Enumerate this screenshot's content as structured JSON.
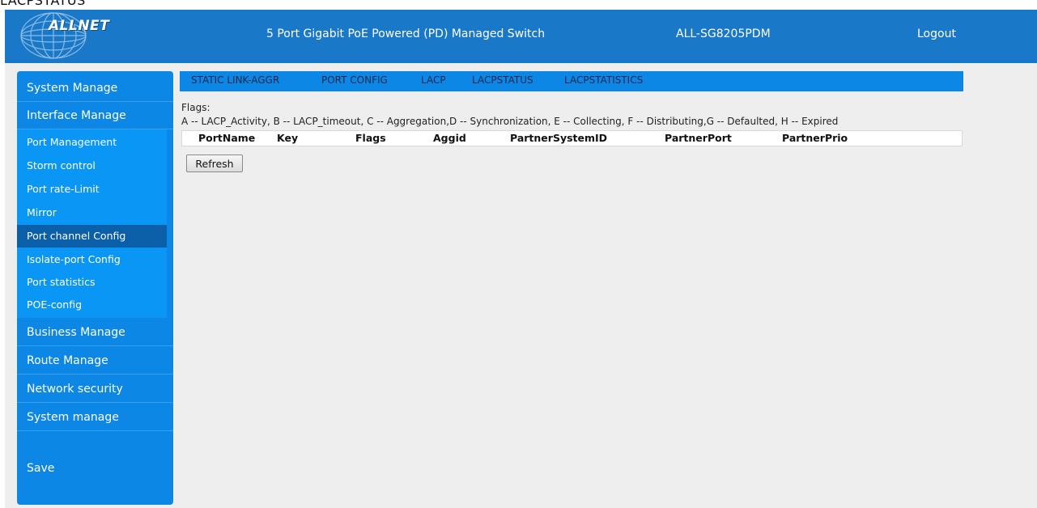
{
  "page_heading": "LACPSTATUS",
  "header": {
    "logo_text": "ALLNET",
    "title": "5 Port Gigabit PoE Powered (PD) Managed Switch",
    "model": "ALL-SG8205PDM",
    "logout_label": "Logout",
    "background_color": "#1a78c8"
  },
  "sidebar": {
    "background_color": "#0c87e6",
    "items_top": [
      {
        "label": "System Manage"
      },
      {
        "label": "Interface Manage"
      }
    ],
    "submenu": [
      {
        "label": "Port Management"
      },
      {
        "label": "Storm control"
      },
      {
        "label": "Port rate-Limit"
      },
      {
        "label": "Mirror"
      },
      {
        "label": "Port channel Config",
        "active": true
      },
      {
        "label": "Isolate-port Config"
      },
      {
        "label": "Port statistics"
      },
      {
        "label": "POE-config"
      }
    ],
    "items_bottom": [
      {
        "label": "Business Manage"
      },
      {
        "label": "Route Manage"
      },
      {
        "label": "Network security"
      },
      {
        "label": "System manage"
      }
    ],
    "save_label": "Save"
  },
  "tabs": [
    {
      "label": "STATIC LINK-AGGR"
    },
    {
      "label": "PORT CONFIG"
    },
    {
      "label": "LACP"
    },
    {
      "label": "LACPSTATUS",
      "active": true
    },
    {
      "label": "LACPSTATISTICS"
    }
  ],
  "flags": {
    "label": "Flags:",
    "legend": "A -- LACP_Activity, B -- LACP_timeout, C -- Aggregation,D -- Synchronization, E -- Collecting, F -- Distributing,G -- Defaulted, H -- Expired"
  },
  "table": {
    "columns": [
      "PortName",
      "Key",
      "Flags",
      "Aggid",
      "PartnerSystemID",
      "PartnerPort",
      "PartnerPrio"
    ],
    "rows": []
  },
  "refresh_label": "Refresh"
}
